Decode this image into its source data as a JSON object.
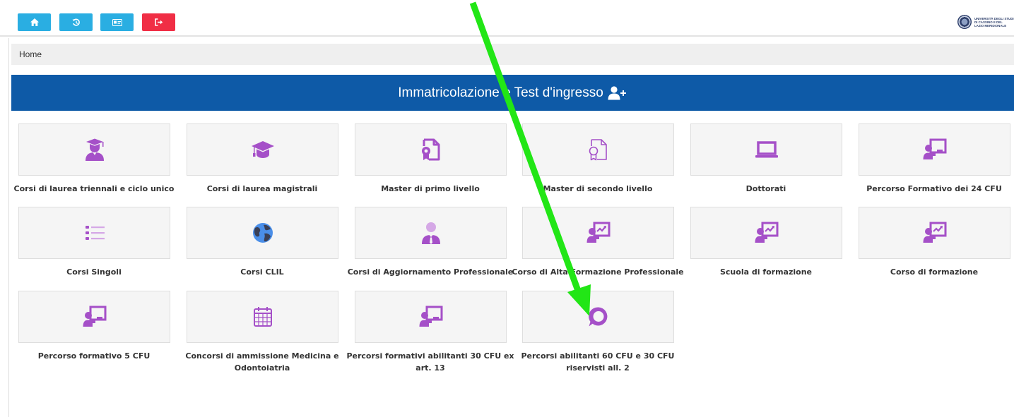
{
  "toolbar": {
    "buttons": [
      {
        "icon": "home-icon",
        "color": "#2aaee2"
      },
      {
        "icon": "history-icon",
        "color": "#2aaee2"
      },
      {
        "icon": "id-card-icon",
        "color": "#2aaee2"
      },
      {
        "icon": "logout-icon",
        "color": "#f02e45"
      }
    ]
  },
  "logo": {
    "text": "UNIVERSITÀ DEGLI STUDI\nDI CASSINO E DEL\nLAZIO MERIDIONALE"
  },
  "breadcrumb": {
    "home": "Home"
  },
  "banner": {
    "title": "Immatricolazione e Test d'ingresso",
    "icon": "user-plus-icon",
    "color": "#0e5aa7"
  },
  "accent_color": "#a550c8",
  "tiles": [
    {
      "label": "Corsi di laurea triennali e ciclo unico",
      "icon": "graduate-student-icon"
    },
    {
      "label": "Corsi di laurea magistrali",
      "icon": "graduation-cap-icon"
    },
    {
      "label": "Master di primo livello",
      "icon": "certificate-icon"
    },
    {
      "label": "Master di secondo livello",
      "icon": "certificate-outline-icon"
    },
    {
      "label": "Dottorati",
      "icon": "laptop-icon"
    },
    {
      "label": "Percorso Formativo dei 24 CFU",
      "icon": "teacher-board-icon"
    },
    {
      "label": "Corsi Singoli",
      "icon": "list-icon"
    },
    {
      "label": "Corsi CLIL",
      "icon": "globe-icon"
    },
    {
      "label": "Corsi di Aggiornamento Professionale",
      "icon": "business-person-icon"
    },
    {
      "label": "Corso di Alta Formazione Professionale",
      "icon": "presentation-chart-icon"
    },
    {
      "label": "Scuola di formazione",
      "icon": "presentation-chart-icon"
    },
    {
      "label": "Corso di formazione",
      "icon": "presentation-chart-icon"
    },
    {
      "label": "Percorso formativo 5 CFU",
      "icon": "teacher-board-icon"
    },
    {
      "label": "Concorsi di ammissione Medicina e Odontoiatria",
      "icon": "calendar-icon"
    },
    {
      "label": "Percorsi formativi abilitanti 30 CFU ex art. 13",
      "icon": "teacher-board-icon"
    },
    {
      "label": "Percorsi abilitanti 60 CFU e 30 CFU riservisti all. 2",
      "icon": "chat-bubble-icon"
    }
  ],
  "annotation": {
    "arrow_color": "#22e616"
  }
}
